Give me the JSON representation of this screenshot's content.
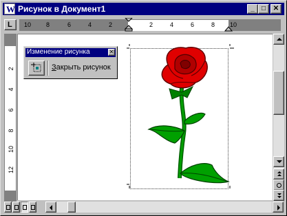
{
  "window": {
    "title": "Рисунок в Документ1",
    "controls": {
      "minimize": "_",
      "maximize": "□",
      "close": "✕"
    }
  },
  "ruler": {
    "tab_selector": "L",
    "horizontal_labels": [
      "10",
      "8",
      "6",
      "4",
      "2",
      "2",
      "4",
      "6",
      "8",
      "10"
    ],
    "vertical_labels": [
      "2",
      "4",
      "6",
      "8",
      "10",
      "12"
    ]
  },
  "floating_toolbar": {
    "title": "Изменение рисунка",
    "close_label": "✕",
    "close_drawing_label": "Закрыть рисунок",
    "icon": "edit-picture-icon"
  },
  "drawing": {
    "subject": "rose-clipart",
    "colors": {
      "petal": "#e00000",
      "petal_dark": "#800000",
      "stem": "#008000",
      "leaf": "#00a000"
    }
  },
  "scrollbars": {
    "vertical_buttons": [
      "scroll-up",
      "scroll-down",
      "prev-page",
      "select-browse-object",
      "next-page"
    ],
    "view_buttons": [
      "normal-view",
      "web-layout-view",
      "page-layout-view",
      "outline-view"
    ]
  }
}
